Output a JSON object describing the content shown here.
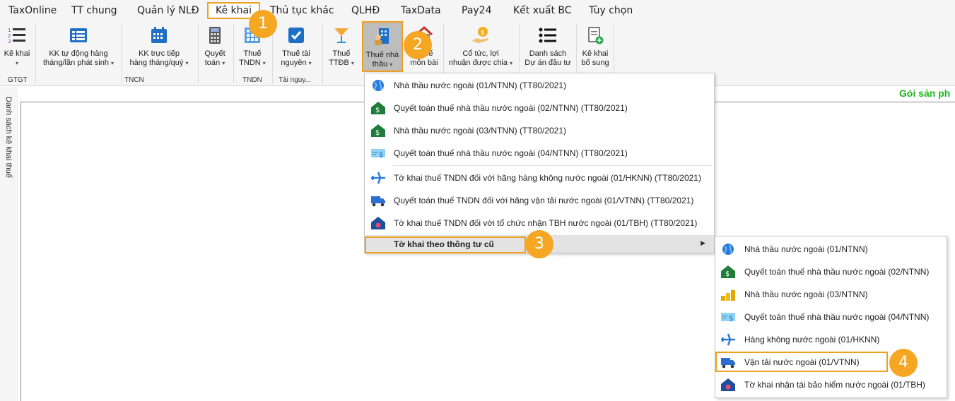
{
  "menubar": {
    "items": [
      "TaxOnline",
      "TT chung",
      "Quản lý NLĐ",
      "Kê khai",
      "Thủ tục khác",
      "QLHĐ",
      "TaxData",
      "Pay24",
      "Kết xuất BC",
      "Tùy chọn"
    ],
    "active": "Kê khai"
  },
  "ribbon": {
    "buttons": {
      "ke_khai": [
        "Kê khai",
        ""
      ],
      "kk_tu_dong": [
        "KK tự động hàng",
        "tháng/lần phát sinh"
      ],
      "kk_truc_tiep": [
        "KK trực tiếp",
        "hàng tháng/quý"
      ],
      "quyet_toan": [
        "Quyết",
        "toán"
      ],
      "thue_tndn": [
        "Thuế",
        "TNDN"
      ],
      "thue_tai_nguyen": [
        "Thuế tài",
        "nguyên"
      ],
      "thue_ttdb": [
        "Thuế",
        "TTĐB"
      ],
      "thue_nha_thau": [
        "Thuế nhà",
        "thầu"
      ],
      "thue_mon_bai": [
        "Thuế",
        "môn bài"
      ],
      "co_tuc": [
        "Cổ tức, lợi",
        "nhuận được chia"
      ],
      "danh_sach_du_an": [
        "Danh sách",
        "Dự án đầu tư"
      ],
      "ke_khai_bo_sung": [
        "Kê khai",
        "bổ sung"
      ]
    },
    "groups": {
      "gtgt": "GTGT",
      "tncn": "TNCN",
      "tndn": "TNDN",
      "tai_nguyen": "Tài nguy..."
    }
  },
  "side_panel": {
    "label": "Danh sách kê khai thuế"
  },
  "product_label": "Gói sản ph",
  "dropdown": {
    "items": [
      "Nhà thầu nước ngoài (01/NTNN) (TT80/2021)",
      "Quyết toán thuế nhà thầu nước ngoài (02/NTNN) (TT80/2021)",
      "Nhà thầu nước ngoài (03/NTNN) (TT80/2021)",
      "Quyết toán thuế nhà thầu nước ngoài (04/NTNN) (TT80/2021)",
      "Tờ khai thuế TNDN đối với hãng hàng không nước ngoài (01/HKNN) (TT80/2021)",
      "Quyết toán thuế TNDN đối với hãng vận tải nước ngoài (01/VTNN) (TT80/2021)",
      "Tờ khai thuế TNDN đối với tổ chức nhận TBH nước ngoài (01/TBH) (TT80/2021)",
      "Tờ khai theo thông tư cũ"
    ],
    "icons": [
      "globe-icon",
      "money-house-icon",
      "money-house-icon",
      "cheque-icon",
      "airplane-icon",
      "truck-icon",
      "insurance-house-icon",
      ""
    ]
  },
  "submenu": {
    "items": [
      "Nhà thầu nước ngoài (01/NTNN)",
      "Quyết toán thuế nhà thầu nước ngoài (02/NTNN)",
      "Nhà thầu nước ngoài (03/NTNN)",
      "Quyết toán thuế nhà thầu nước ngoài (04/NTNN)",
      "Hàng không nước ngoài (01/HKNN)",
      "Vận tải nước ngoài (01/VTNN)",
      "Tờ khai nhận tái bảo hiểm nước ngoài (01/TBH)"
    ],
    "icons": [
      "globe-icon",
      "money-house-icon",
      "coins-icon",
      "cheque-icon",
      "airplane-icon",
      "truck-icon",
      "insurance-house-icon"
    ]
  },
  "steps": [
    "1",
    "2",
    "3",
    "4"
  ],
  "colors": {
    "highlight": "#f0a020",
    "badge": "#f5a623",
    "product": "#1fb51f",
    "ribbon_bg": "#f5f5f5"
  }
}
